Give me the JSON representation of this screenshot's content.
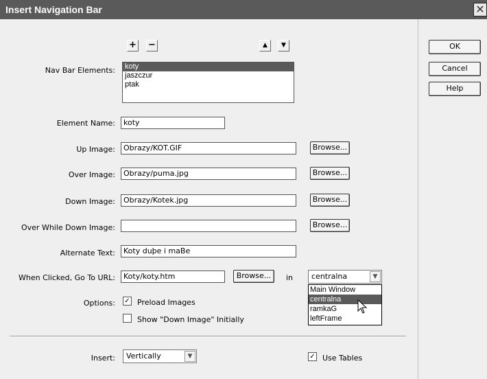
{
  "window": {
    "title": "Insert Navigation Bar",
    "close_symbol": "✕"
  },
  "toolbar": {
    "add_symbol": "+",
    "remove_symbol": "−",
    "up_symbol": "▲",
    "down_symbol": "▼"
  },
  "nav_bar": {
    "label": "Nav Bar Elements:",
    "items": [
      "koty",
      "jaszczur",
      "ptak"
    ],
    "selected": "koty"
  },
  "element_name": {
    "label": "Element Name:",
    "value": "koty"
  },
  "up_image": {
    "label": "Up Image:",
    "value": "Obrazy/KOT.GIF"
  },
  "over_image": {
    "label": "Over Image:",
    "value": "Obrazy/puma.jpg"
  },
  "down_image": {
    "label": "Down Image:",
    "value": "Obrazy/Kotek.jpg"
  },
  "over_while_down_image": {
    "label": "Over While Down Image:",
    "value": ""
  },
  "alternate_text": {
    "label": "Alternate Text:",
    "value": "Koty duþe i maBe"
  },
  "when_clicked": {
    "label": "When Clicked, Go To URL:",
    "value": "Koty/koty.htm",
    "in_label": "in",
    "target_selected": "centralna",
    "target_options": [
      "Main Window",
      "centralna",
      "ramkaG",
      "leftFrame"
    ]
  },
  "browse_label": "Browse...",
  "options": {
    "label": "Options:",
    "preload_label": "Preload Images",
    "preload_checked": true,
    "show_down_label": "Show \"Down Image\" Initially",
    "show_down_checked": false
  },
  "insert": {
    "label": "Insert:",
    "selected": "Vertically",
    "use_tables_label": "Use Tables",
    "use_tables_checked": true
  },
  "buttons": {
    "ok": "OK",
    "cancel": "Cancel",
    "help": "Help"
  }
}
